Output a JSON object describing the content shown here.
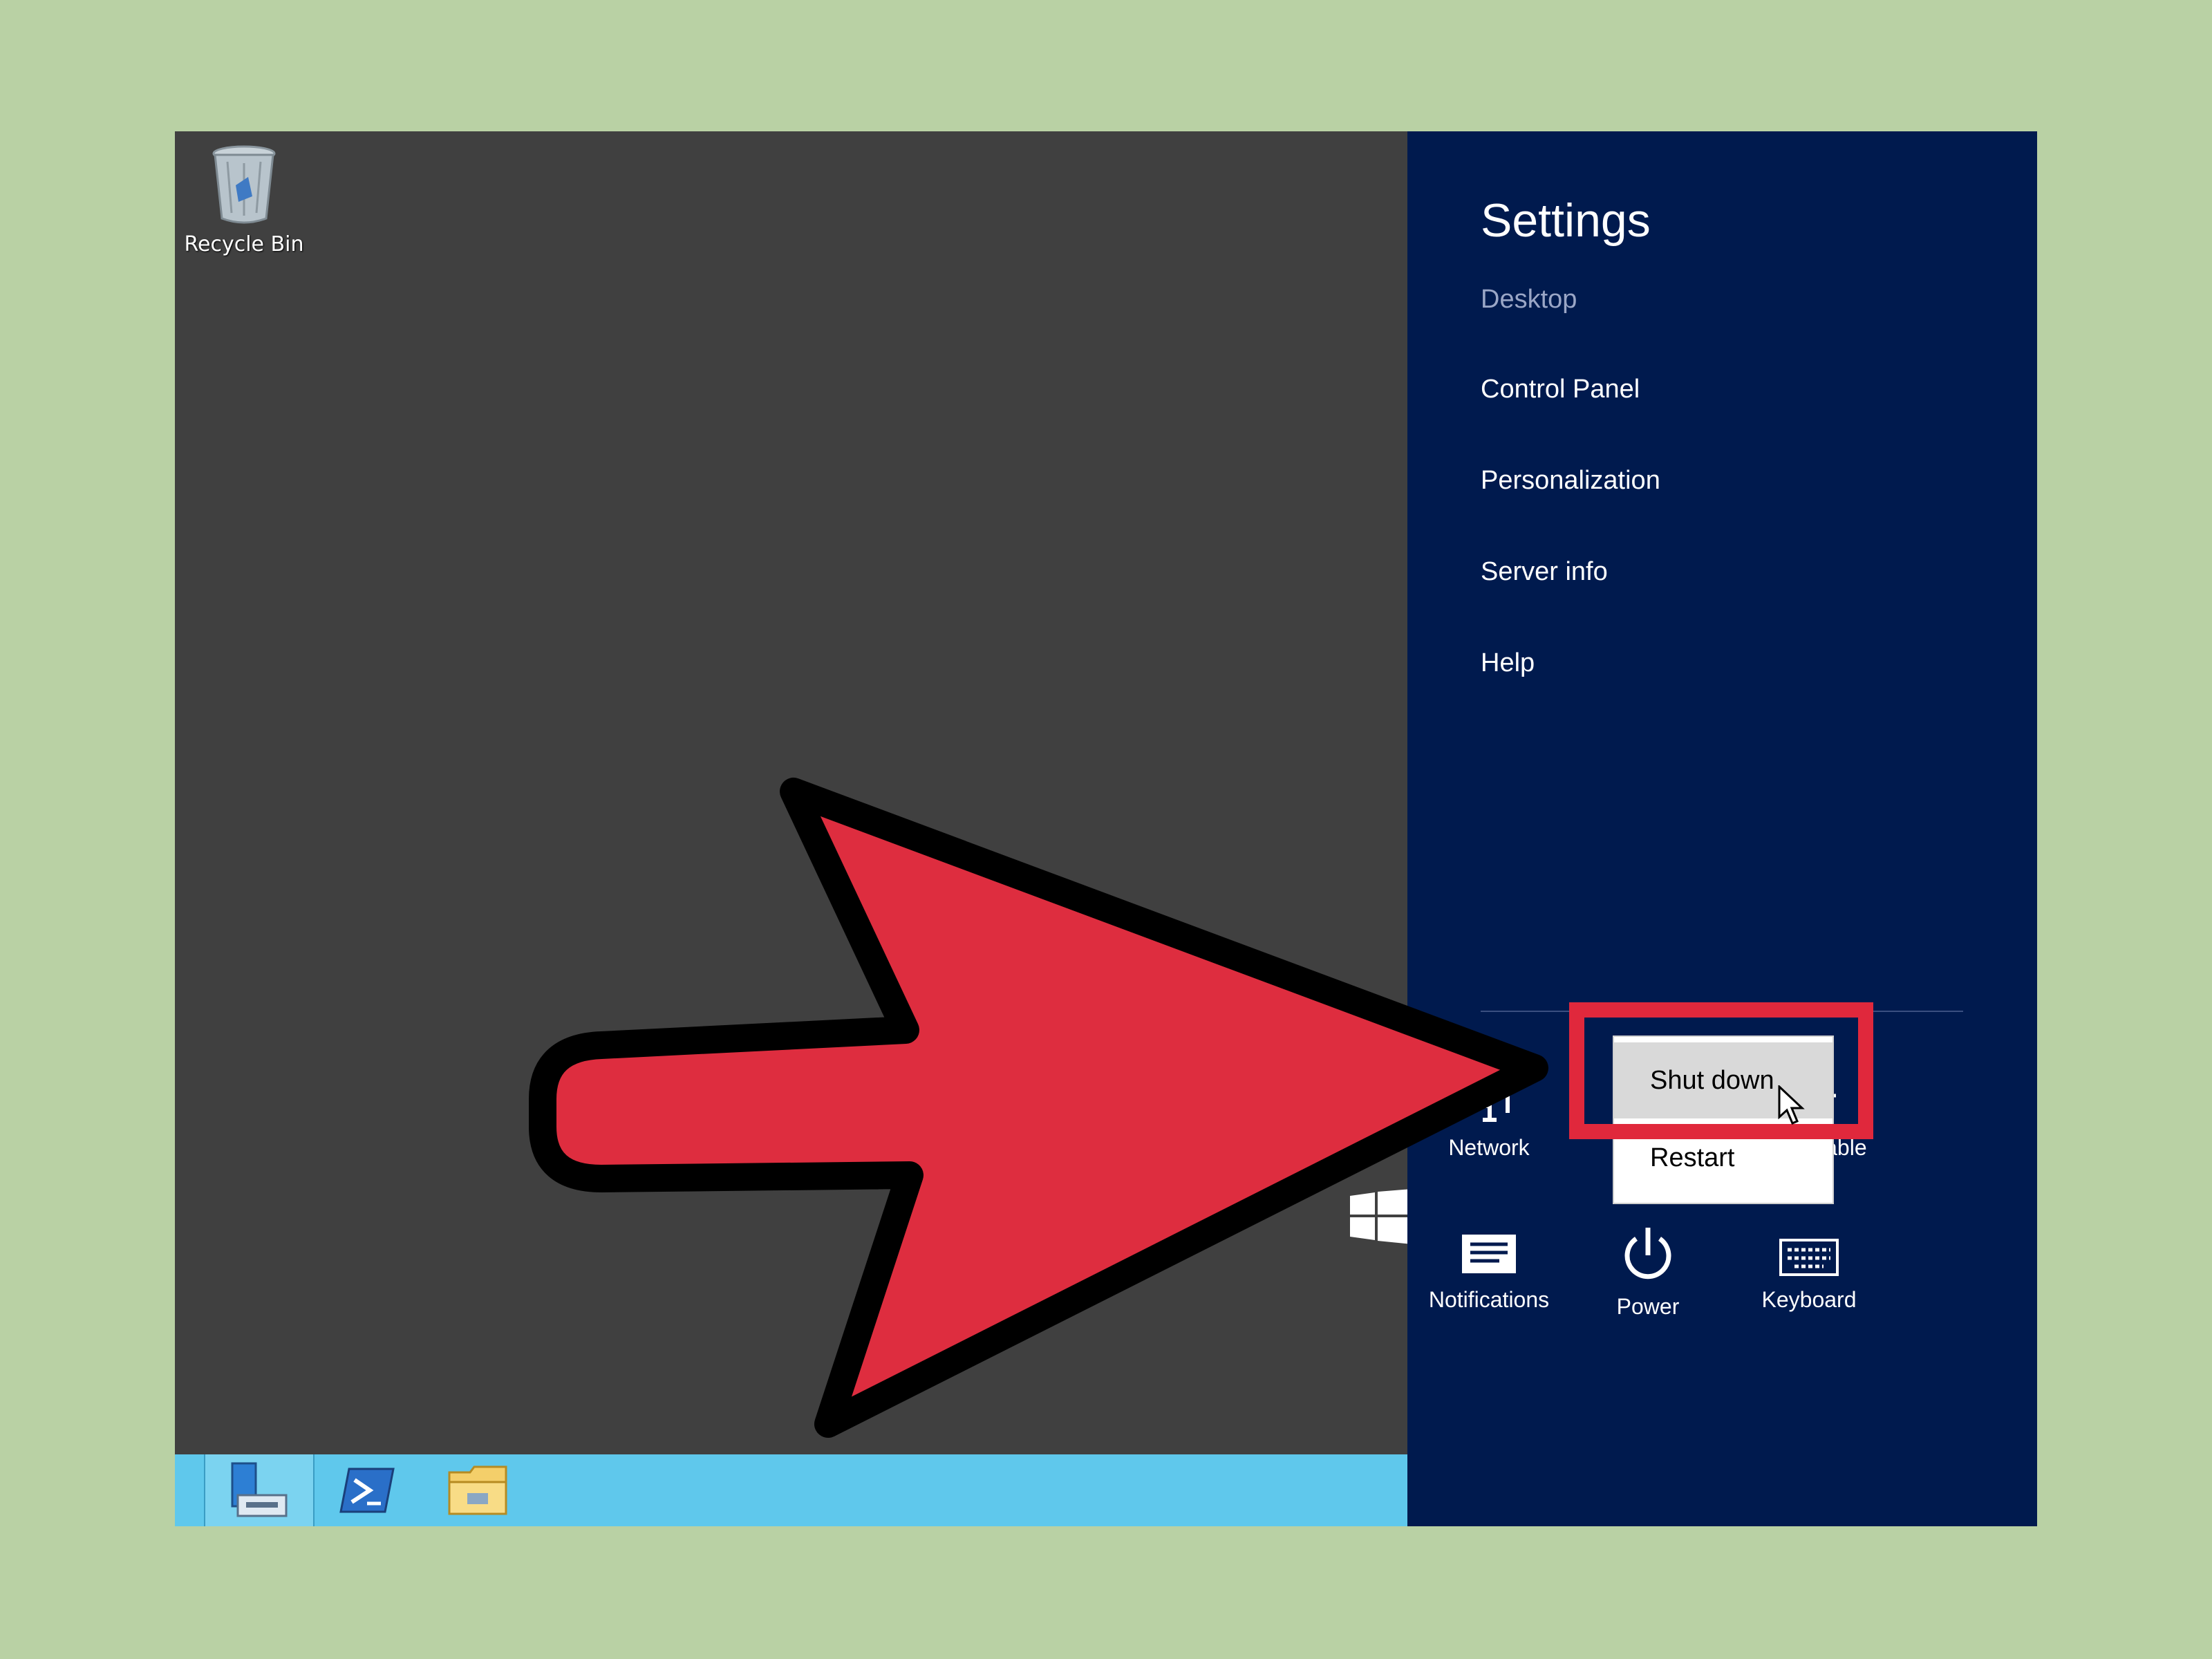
{
  "desktop": {
    "recycle_bin_label": "Recycle Bin"
  },
  "charms": {
    "title": "Settings",
    "subtitle": "Desktop",
    "items": [
      {
        "label": "Control Panel"
      },
      {
        "label": "Personalization"
      },
      {
        "label": "Server info"
      },
      {
        "label": "Help"
      }
    ],
    "tiles": {
      "network": "Network",
      "unavailable": "Unavailable",
      "notifications": "Notifications",
      "power": "Power",
      "keyboard": "Keyboard"
    }
  },
  "power_menu": {
    "shut_down": "Shut down",
    "restart": "Restart"
  },
  "colors": {
    "background": "#b9d1a4",
    "charms_bg": "#001a4e",
    "taskbar": "#5fc8ec",
    "highlight": "#e0283c",
    "arrow_fill": "#de2d3f"
  },
  "icons": [
    "recycle-bin-icon",
    "windows-logo-icon",
    "server-manager-icon",
    "powershell-icon",
    "file-explorer-icon",
    "network-icon",
    "brightness-icon",
    "notifications-icon",
    "power-icon",
    "keyboard-icon",
    "mouse-cursor-icon"
  ]
}
